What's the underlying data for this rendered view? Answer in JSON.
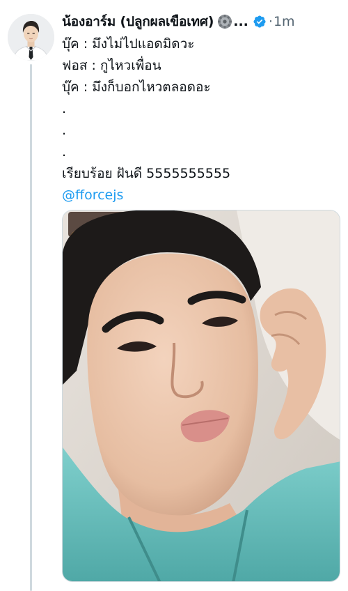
{
  "tweet": {
    "display_name": "น้องอาร์ม (ปลูกผลเขือเทศ)",
    "name_ellipsis": "...",
    "name_emoji": "gear-emoji",
    "verified_icon": "verified-badge-icon",
    "separator": "·",
    "time": "1m",
    "lines": [
      "บุ๊ค : มึงไม่ไปแอดมิดวะ",
      "ฟอส : กูไหวเพื่อน",
      "บุ๊ค : มึงก็บอกไหวตลอดอะ",
      ".",
      ".",
      ".",
      "เรียบร้อย ฝันดี 5555555555"
    ],
    "mention": "@fforcejs"
  },
  "colors": {
    "text": "#0f1419",
    "secondary": "#536471",
    "link": "#1d9bf0",
    "verified": "#1d9bf0",
    "thread_line": "#cfd9de",
    "border": "#cfd9de"
  }
}
